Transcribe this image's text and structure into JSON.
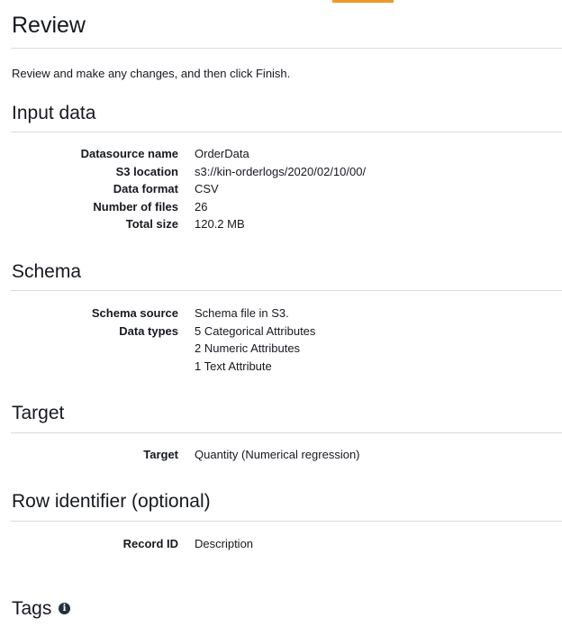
{
  "page": {
    "title": "Review",
    "intro": "Review and make any changes, and then click Finish."
  },
  "sections": {
    "input_data": {
      "title": "Input data",
      "rows": [
        {
          "label": "Datasource name",
          "value": "OrderData"
        },
        {
          "label": "S3 location",
          "value": "s3://kin-orderlogs/2020/02/10/00/"
        },
        {
          "label": "Data format",
          "value": "CSV"
        },
        {
          "label": "Number of files",
          "value": "26"
        },
        {
          "label": "Total size",
          "value": "120.2 MB"
        }
      ]
    },
    "schema": {
      "title": "Schema",
      "rows": [
        {
          "label": "Schema source",
          "value": "Schema file in S3."
        },
        {
          "label": "Data types",
          "value": "5 Categorical Attributes"
        },
        {
          "label": "",
          "value": "2 Numeric Attributes"
        },
        {
          "label": "",
          "value": "1 Text Attribute"
        }
      ]
    },
    "target": {
      "title": "Target",
      "rows": [
        {
          "label": "Target",
          "value": "Quantity (Numerical regression)"
        }
      ]
    },
    "row_identifier": {
      "title": "Row identifier (optional)",
      "rows": [
        {
          "label": "Record ID",
          "value": "Description"
        }
      ]
    },
    "tags": {
      "title": "Tags",
      "icon": "info-icon"
    }
  },
  "colors": {
    "accent": "#ec9a2b",
    "text": "#16191f",
    "divider": "#d5dbdb"
  }
}
